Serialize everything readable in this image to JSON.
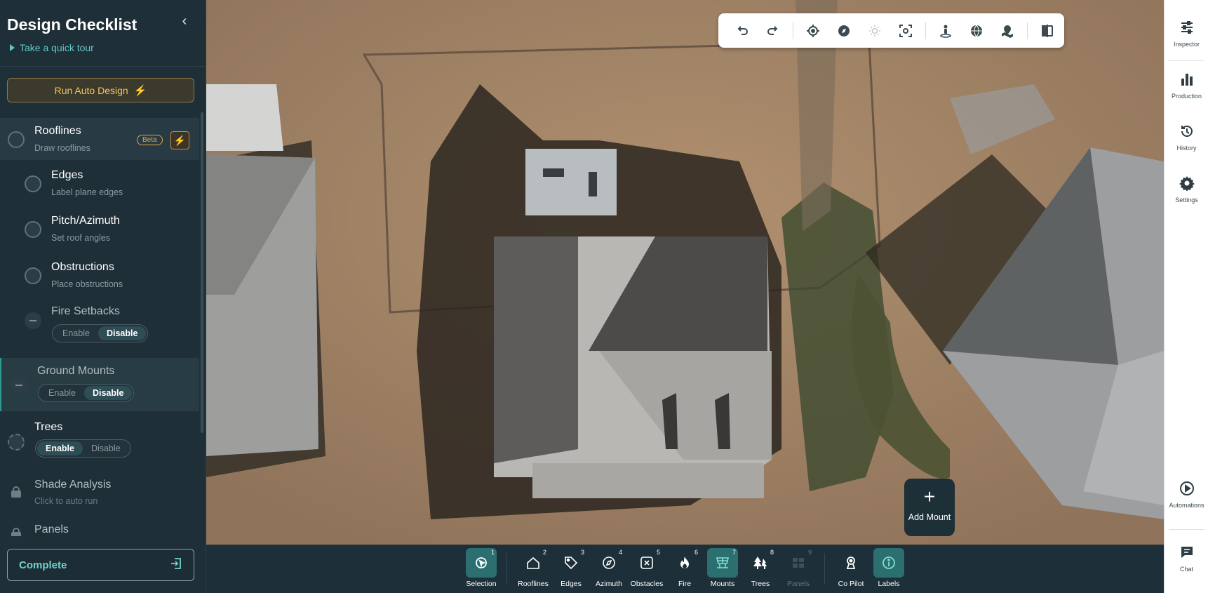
{
  "sidebar": {
    "title": "Design Checklist",
    "collapse_icon": "‹",
    "tour_label": "Take a quick tour",
    "auto_design_label": "Run Auto Design",
    "steps": {
      "rooflines": {
        "name": "Rooflines",
        "sub": "Draw rooflines",
        "badge": "Beta"
      },
      "edges": {
        "name": "Edges",
        "sub": "Label plane edges"
      },
      "pitch": {
        "name": "Pitch/Azimuth",
        "sub": "Set roof angles"
      },
      "obstructions": {
        "name": "Obstructions",
        "sub": "Place obstructions"
      },
      "fire": {
        "name": "Fire Setbacks",
        "enable": "Enable",
        "disable": "Disable",
        "selected": "Disable"
      },
      "ground": {
        "name": "Ground Mounts",
        "enable": "Enable",
        "disable": "Disable",
        "selected": "Disable"
      },
      "trees": {
        "name": "Trees",
        "enable": "Enable",
        "disable": "Disable",
        "selected": "Enable"
      },
      "shade": {
        "name": "Shade Analysis",
        "sub": "Click to auto run"
      },
      "panels": {
        "name": "Panels"
      }
    },
    "complete_label": "Complete"
  },
  "map_toolbar": {
    "icons": [
      "undo-icon",
      "redo-icon",
      "locate-icon",
      "compass-icon",
      "sun-icon",
      "focus-icon",
      "street-view-icon",
      "globe-icon",
      "map-pin-icon",
      "split-view-icon"
    ]
  },
  "add_mount": {
    "label": "Add Mount"
  },
  "bottom_toolbar": {
    "items": [
      {
        "label": "Selection",
        "num": "1"
      },
      {
        "label": "Rooflines",
        "num": "2"
      },
      {
        "label": "Edges",
        "num": "3"
      },
      {
        "label": "Azimuth",
        "num": "4"
      },
      {
        "label": "Obstacles",
        "num": "5"
      },
      {
        "label": "Fire",
        "num": "6"
      },
      {
        "label": "Mounts",
        "num": "7"
      },
      {
        "label": "Trees",
        "num": "8"
      },
      {
        "label": "Panels",
        "num": "9"
      },
      {
        "label": "Co Pilot",
        "num": ""
      },
      {
        "label": "Labels",
        "num": ""
      }
    ]
  },
  "right_rail": {
    "inspector": "Inspector",
    "production": "Production",
    "history": "History",
    "settings": "Settings",
    "automations": "Automations",
    "chat": "Chat"
  },
  "colors": {
    "sidebar_bg": "#1f2f38",
    "accent_teal": "#5ec8c8",
    "accent_gold": "#f2c45b",
    "toolbar_selected": "#2b6f70"
  }
}
